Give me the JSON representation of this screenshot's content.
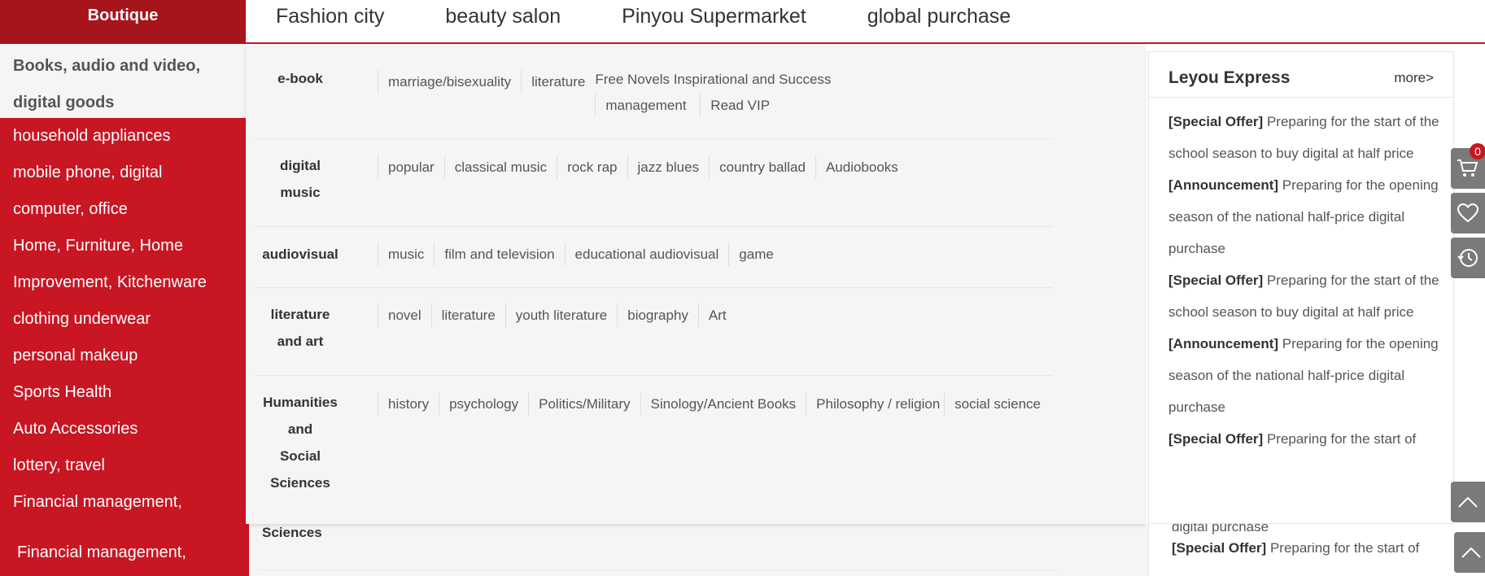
{
  "header": {
    "brand": "Boutique",
    "nav": [
      "Fashion city",
      "beauty salon",
      "Pinyou Supermarket",
      "global purchase"
    ]
  },
  "sidebar": {
    "active_line1": "Books, audio and video,",
    "active_line2": "digital goods",
    "items": [
      "household appliances",
      "mobile phone, digital",
      "computer, office",
      "Home, Furniture, Home",
      "Improvement, Kitchenware",
      "clothing underwear",
      "personal makeup",
      "Sports Health",
      "Auto Accessories",
      "lottery, travel",
      "Financial management,"
    ]
  },
  "popup": {
    "ebook": {
      "label": "e-book",
      "items": [
        "marriage/bisexuality",
        "literature"
      ],
      "stack_top": "Free Novels Inspirational and Success",
      "stack_bottom": [
        "management",
        "Read VIP"
      ]
    },
    "digital_music": {
      "label_1": "digital",
      "label_2": "music",
      "items": [
        "popular",
        "classical music",
        "rock rap",
        "jazz blues",
        "country ballad",
        "Audiobooks"
      ]
    },
    "audiovisual": {
      "label": "audiovisual",
      "items": [
        "music",
        "film and television",
        "educational audiovisual",
        "game"
      ]
    },
    "literature_art": {
      "label_1": "literature",
      "label_2": "and art",
      "items": [
        "novel",
        "literature",
        "youth literature",
        "biography",
        "Art"
      ]
    },
    "humanities": {
      "label_1": "Humanities",
      "label_2": "and",
      "label_3": "Social",
      "label_4": "Sciences",
      "items": [
        "history",
        "psychology",
        "Politics/Military",
        "Sinology/Ancient Books",
        "Philosophy / religion",
        "social science"
      ]
    }
  },
  "news": {
    "title": "Leyou Express",
    "more": "more>",
    "items": [
      {
        "tag": "[Special Offer]",
        "text": "Preparing for the start of the school season to buy digital at half price"
      },
      {
        "tag": "[Announcement]",
        "text": "Preparing for the opening season of the national half-price digital purchase"
      },
      {
        "tag": "[Special Offer]",
        "text": "Preparing for the start of the school season to buy digital at half price"
      },
      {
        "tag": "[Announcement]",
        "text": "Preparing for the opening season of the national half-price digital purchase"
      },
      {
        "tag": "[Special Offer]",
        "text": "Preparing for the start of"
      }
    ]
  },
  "ghost": {
    "sidebar_item": "Financial management,",
    "popup_label": "Sciences",
    "news_strip": "digital purchase",
    "news_tag": "[Special Offer]",
    "news_text": "Preparing for the start of"
  },
  "toolbar": {
    "cart_count": "0",
    "icons": [
      "cart-icon",
      "heart-icon",
      "history-icon",
      "chevron-up-icon"
    ],
    "tool_color": "#7a7a7a",
    "accent": "#c81623"
  }
}
